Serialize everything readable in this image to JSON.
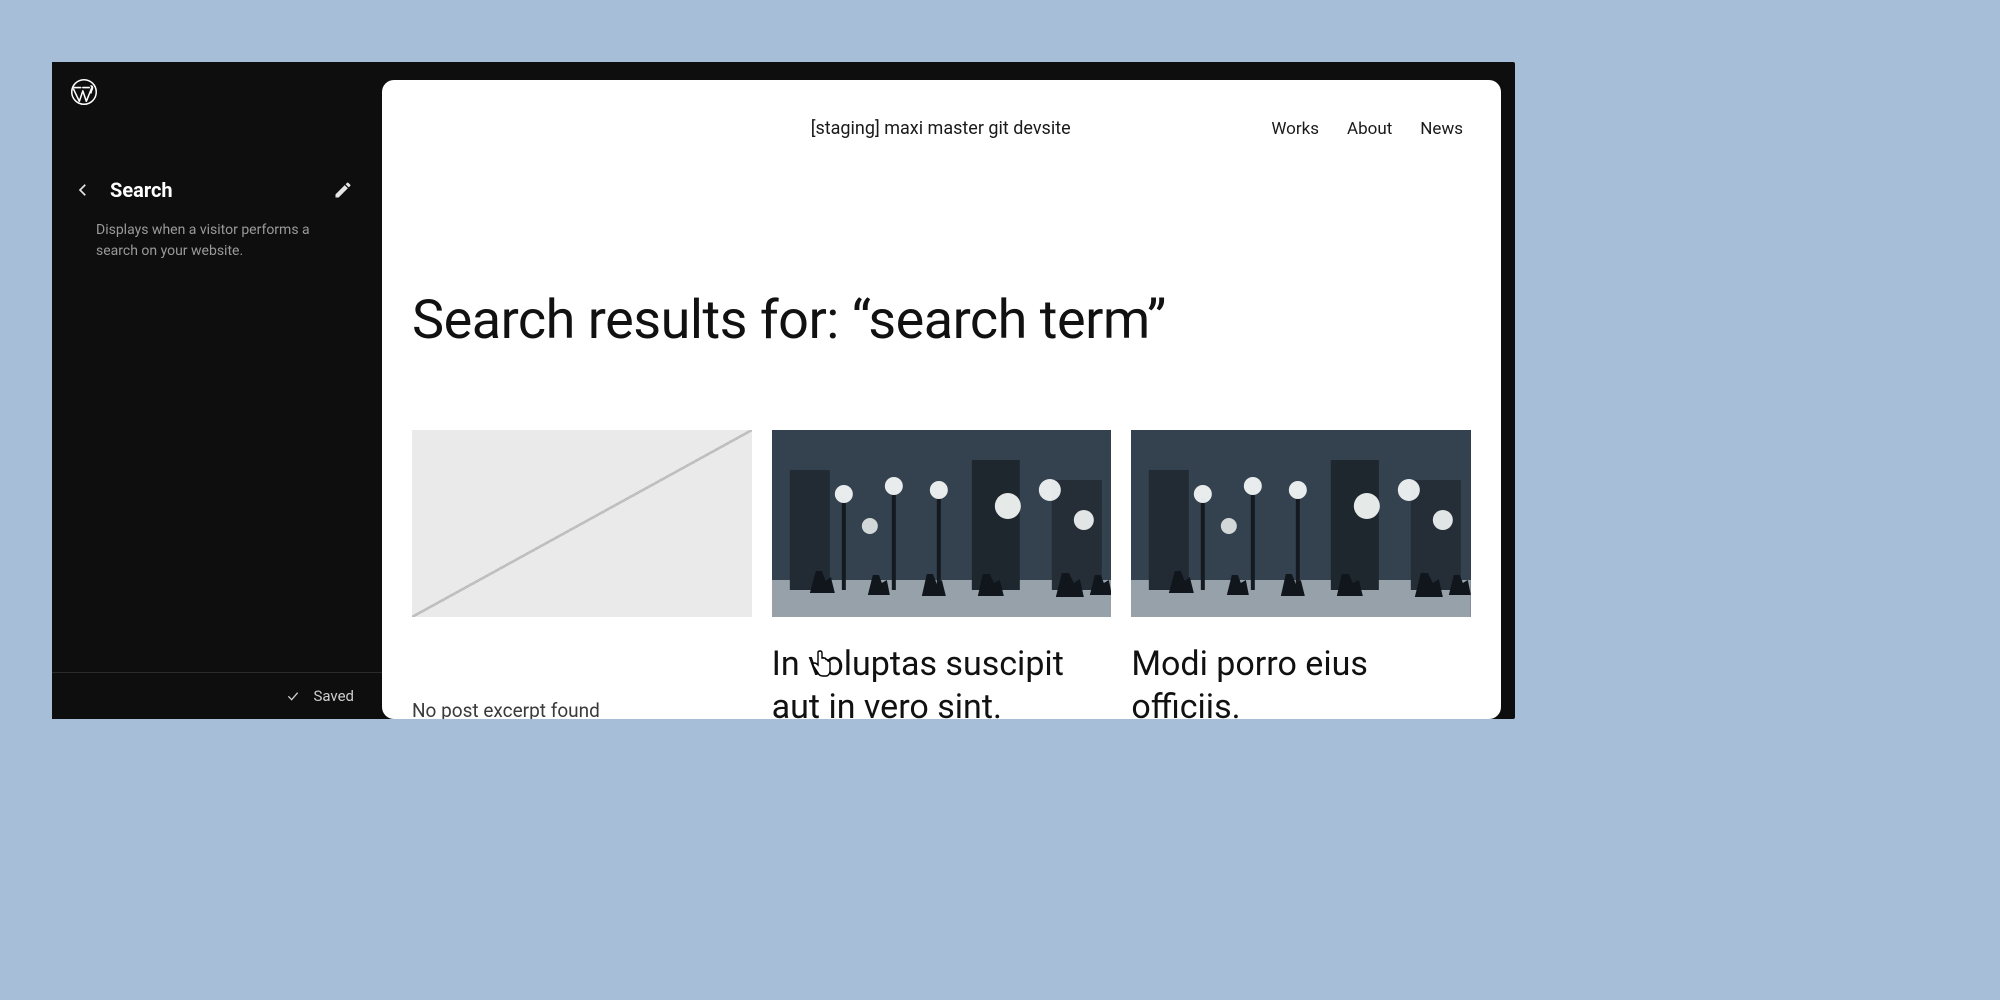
{
  "sidebar": {
    "title": "Search",
    "description": "Displays when a visitor performs a search on your website.",
    "saved_label": "Saved"
  },
  "site": {
    "title": "[staging] maxi master git devsite",
    "nav": [
      "Works",
      "About",
      "News"
    ]
  },
  "page": {
    "heading": "Search results for: “search term”"
  },
  "results": [
    {
      "title": "",
      "excerpt": "No post excerpt found",
      "has_image": false
    },
    {
      "title": "In voluptas suscipit aut in vero sint.",
      "excerpt": "",
      "has_image": true
    },
    {
      "title": "Modi porro eius officiis.",
      "excerpt": "",
      "has_image": true
    }
  ]
}
